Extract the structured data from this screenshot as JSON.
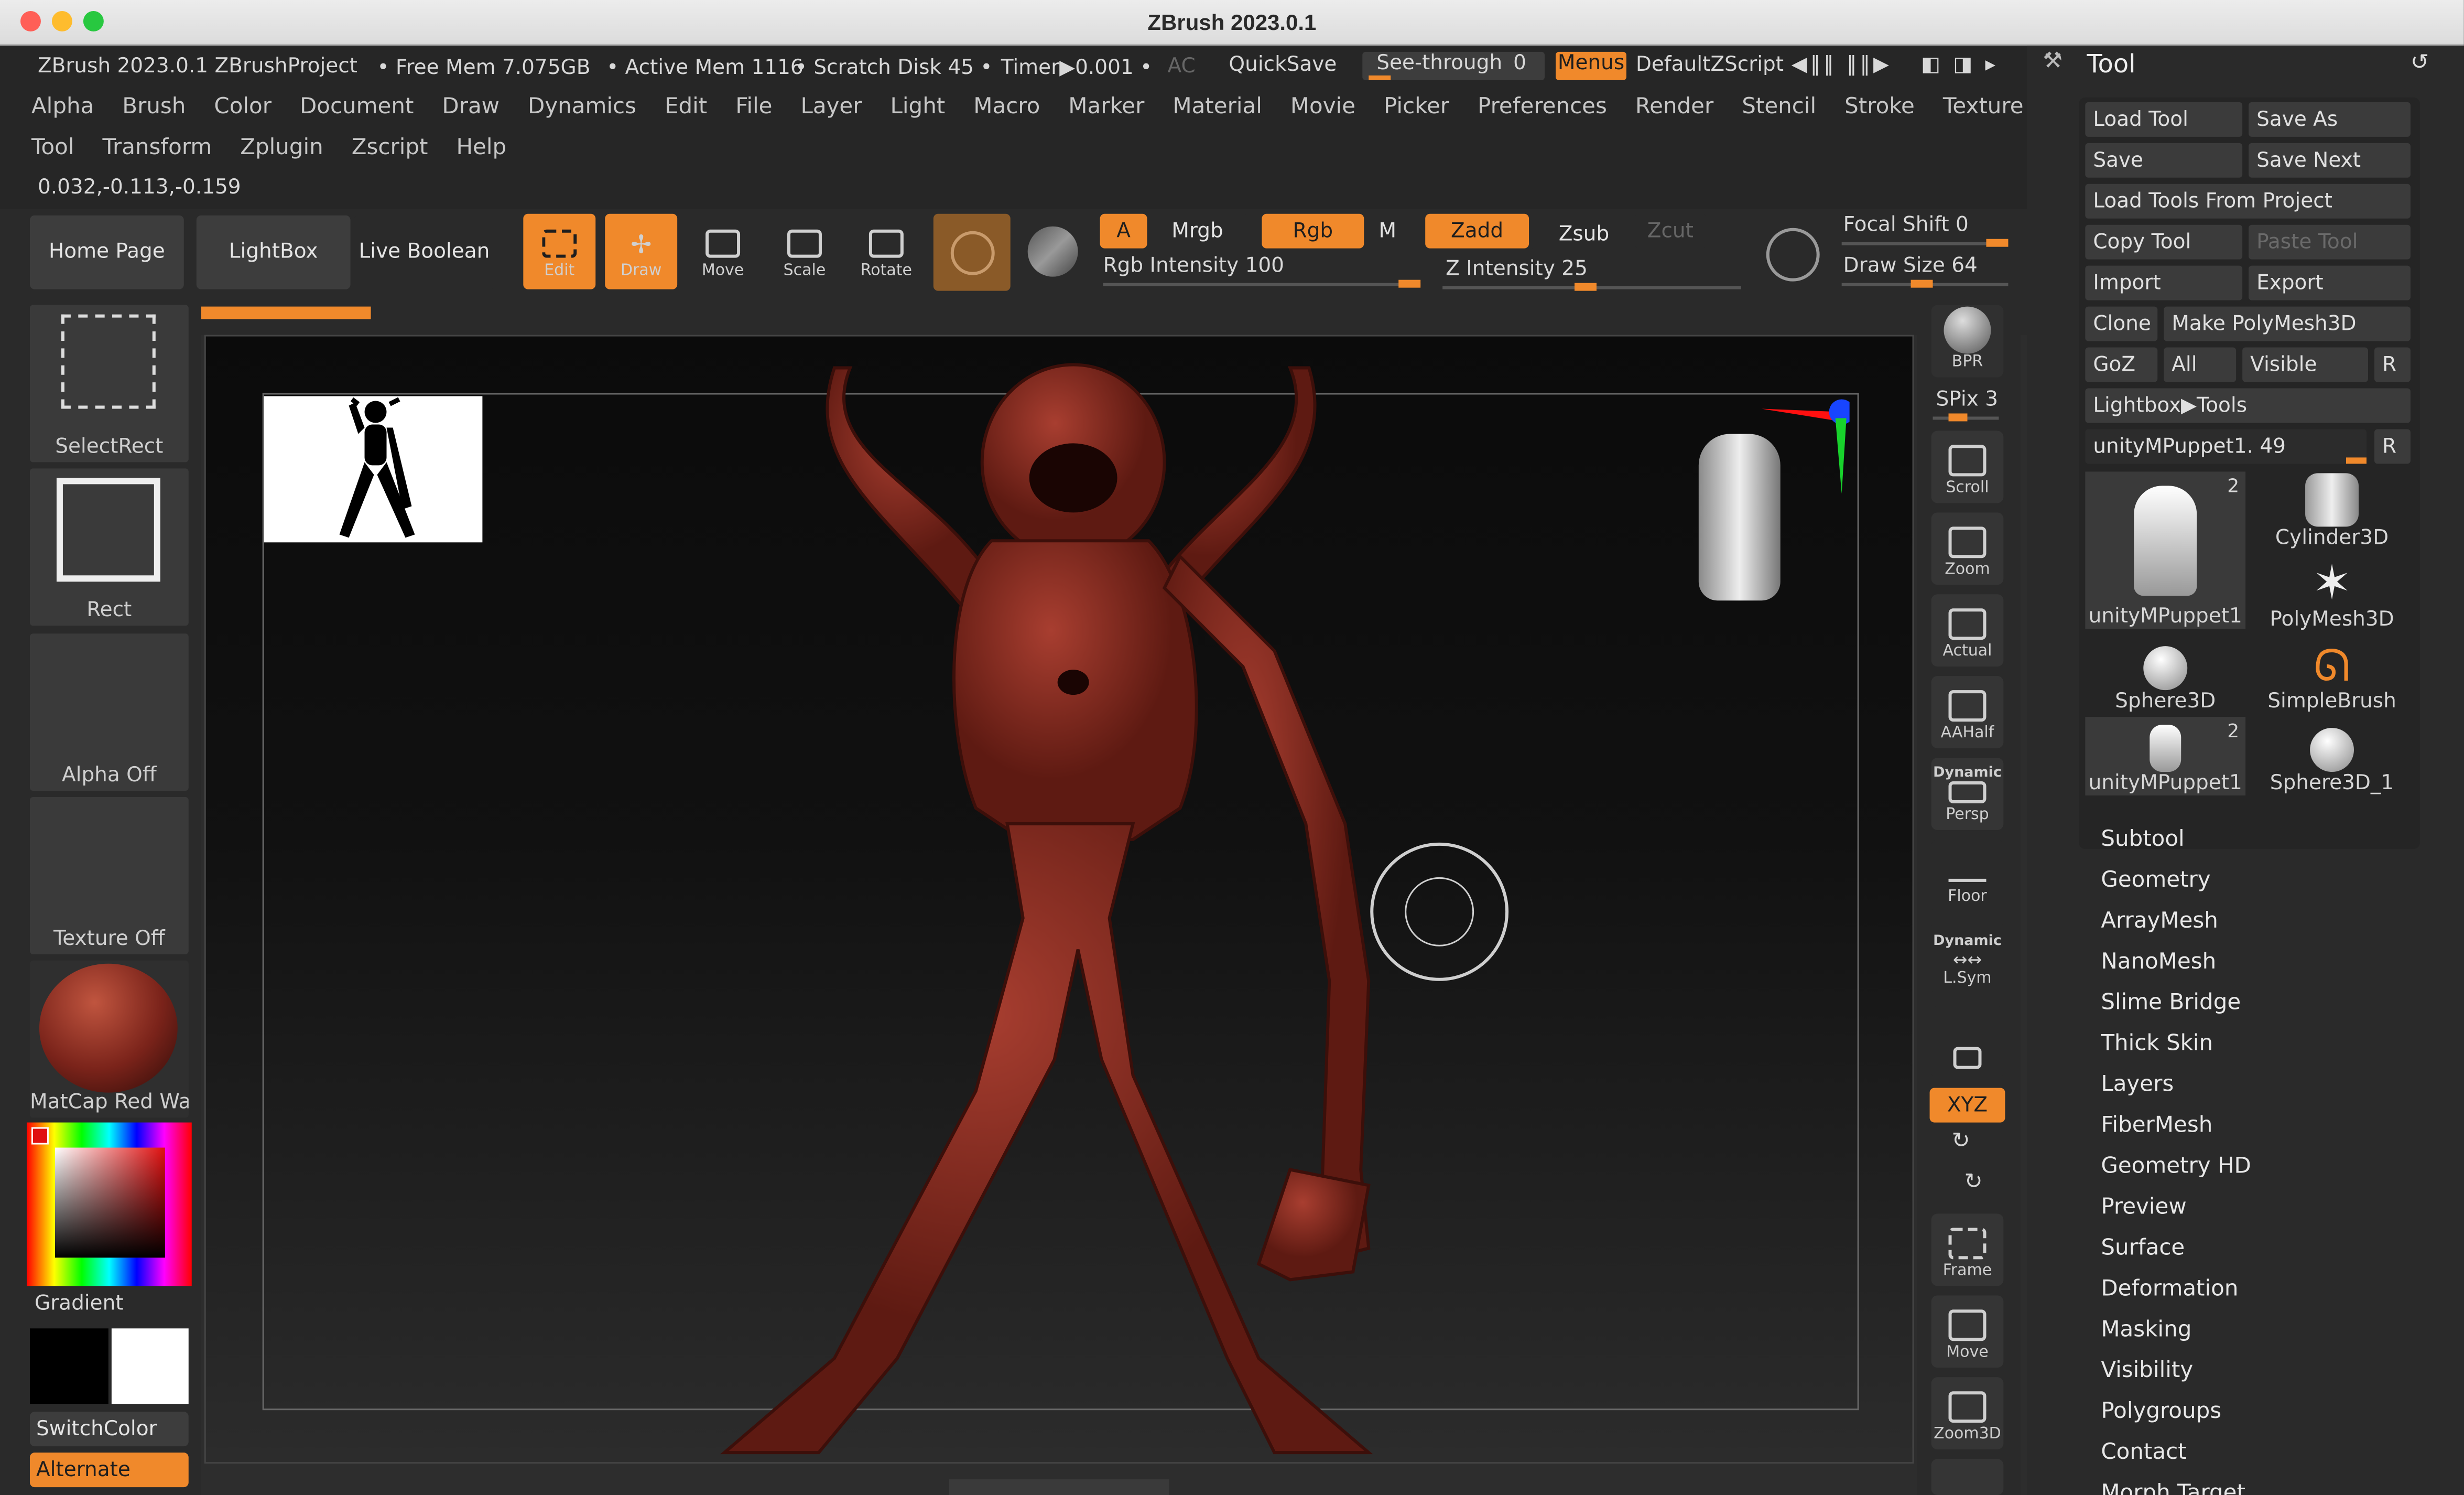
{
  "window": {
    "title": "ZBrush 2023.0.1"
  },
  "status": {
    "app": "ZBrush 2023.0.1 ZBrushProject",
    "free_mem": "• Free Mem 7.075GB",
    "active_mem": "• Active Mem 1116",
    "scratch": "• Scratch Disk 45 •",
    "timer": "Timer▶0.001 •",
    "ac": "AC",
    "quicksave": "QuickSave",
    "seethrough": "See-through",
    "seethrough_val": "0",
    "menus": "Menus",
    "defaultzscript": "DefaultZScript"
  },
  "menu": [
    "Alpha",
    "Brush",
    "Color",
    "Document",
    "Draw",
    "Dynamics",
    "Edit",
    "File",
    "Layer",
    "Light",
    "Macro",
    "Marker",
    "Material",
    "Movie",
    "Picker",
    "Preferences",
    "Render",
    "Stencil",
    "Stroke",
    "Texture"
  ],
  "menu2": [
    "Tool",
    "Transform",
    "Zplugin",
    "Zscript",
    "Help"
  ],
  "coords": "0.032,-0.113,-0.159",
  "shelf": {
    "home": "Home Page",
    "lightbox": "LightBox",
    "liveboolean": "Live Boolean",
    "edit": "Edit",
    "draw": "Draw",
    "move": "Move",
    "scale": "Scale",
    "rotate": "Rotate",
    "a": "A",
    "mrgb": "Mrgb",
    "rgb": "Rgb",
    "m": "M",
    "zadd": "Zadd",
    "zsub": "Zsub",
    "zcut": "Zcut",
    "rgb_intensity": "Rgb Intensity 100",
    "z_intensity": "Z Intensity 25",
    "focal_shift": "Focal Shift 0",
    "draw_size": "Draw Size 64",
    "rgb_intensity_value": 100,
    "z_intensity_value": 25,
    "focal_shift_value": 0,
    "draw_size_value": 64
  },
  "left": {
    "selectrect": "SelectRect",
    "rect": "Rect",
    "alpha": "Alpha Off",
    "texture": "Texture Off",
    "material": "MatCap Red Wa",
    "gradient": "Gradient",
    "switchcolor": "SwitchColor",
    "alternate": "Alternate"
  },
  "right": {
    "bpr": "BPR",
    "spix": "SPix 3",
    "scroll": "Scroll",
    "zoom": "Zoom",
    "actual": "Actual",
    "aahalf": "AAHalf",
    "dynamic": "Dynamic",
    "persp": "Persp",
    "floor": "Floor",
    "dynamic2": "Dynamic",
    "lsym": "L.Sym",
    "xyz": "XYZ",
    "frame": "Frame",
    "move": "Move",
    "zoom3d": "Zoom3D"
  },
  "tool": {
    "title": "Tool",
    "load": "Load Tool",
    "saveas": "Save As",
    "save": "Save",
    "savenext": "Save Next",
    "loadproject": "Load Tools From Project",
    "copy": "Copy Tool",
    "paste": "Paste Tool",
    "import": "Import",
    "export": "Export",
    "clone": "Clone",
    "makepoly": "Make PolyMesh3D",
    "goz": "GoZ",
    "all": "All",
    "visible": "Visible",
    "r": "R",
    "lightbox": "Lightbox▶Tools",
    "current": "unityMPuppet1. 49",
    "current_r": "R",
    "thumbs": [
      {
        "name": "unityMPuppet1",
        "badge": "2"
      },
      {
        "name": "Cylinder3D",
        "badge": ""
      },
      {
        "name": "PolyMesh3D",
        "badge": ""
      },
      {
        "name": "Sphere3D",
        "badge": ""
      },
      {
        "name": "SimpleBrush",
        "badge": ""
      },
      {
        "name": "unityMPuppet1",
        "badge": "2"
      },
      {
        "name": "Sphere3D_1",
        "badge": ""
      }
    ],
    "subpalettes": [
      "Subtool",
      "Geometry",
      "ArrayMesh",
      "NanoMesh",
      "Slime Bridge",
      "Thick Skin",
      "Layers",
      "FiberMesh",
      "Geometry HD",
      "Preview",
      "Surface",
      "Deformation",
      "Masking",
      "Visibility",
      "Polygroups",
      "Contact",
      "Morph Target"
    ]
  },
  "colors": {
    "accent": "#f0892b",
    "model": "#8e2e22"
  }
}
